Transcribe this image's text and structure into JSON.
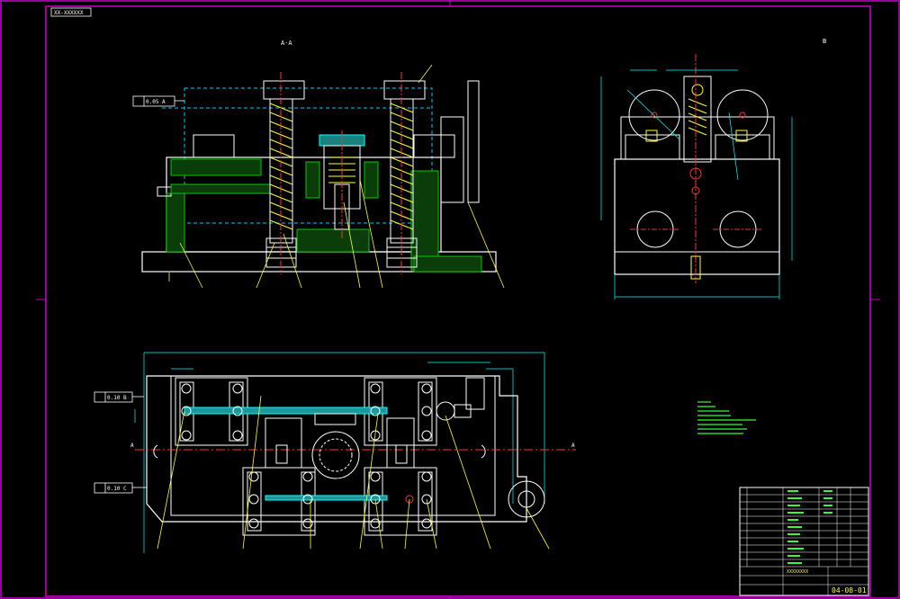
{
  "drawing": {
    "corner_tag": "XX-XXXXXX",
    "view_section_label": "A-A",
    "view_side_label": "B",
    "tolerance_frame_top": "0.05 A",
    "tolerance_frame_plan_1": "0.10 B",
    "tolerance_frame_plan_2": "0.10 C",
    "drawing_number": "04-08-01",
    "title_block_name": "XXXXXXXX",
    "colors": {
      "background": "#000000",
      "border": "#cc00cc",
      "outline": "#ffffff",
      "hatch": "#00cc00",
      "dimension": "#00ffff",
      "hidden": "#00ccff",
      "leader": "#ffff00",
      "centerline": "#ff3333",
      "notes": "#33ff33"
    },
    "icons": [
      "bolt-icon",
      "hex-nut-icon",
      "locating-pin-icon"
    ]
  }
}
